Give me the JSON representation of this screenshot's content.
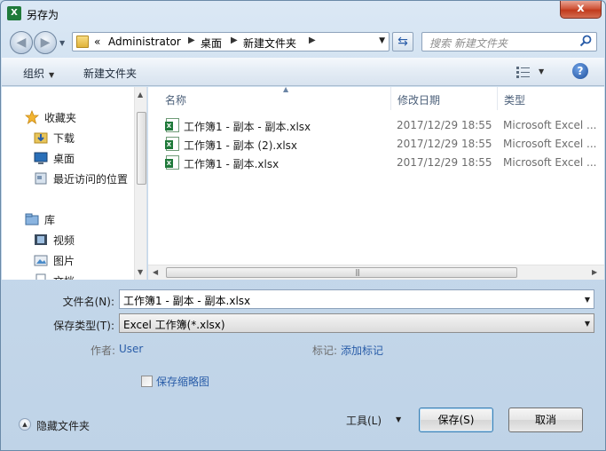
{
  "window": {
    "title": "另存为",
    "app_icon_letter": "X",
    "close_label": "x"
  },
  "nav": {
    "back_symbol": "◀",
    "forward_symbol": "▶",
    "breadcrumb": [
      "Administrator",
      "桌面",
      "新建文件夹"
    ],
    "overflow": "«",
    "refresh_symbol": "⇆",
    "search_placeholder": "搜索 新建文件夹"
  },
  "toolbar": {
    "organize": "组织",
    "new_folder": "新建文件夹",
    "help": "?"
  },
  "sidebar": {
    "items": [
      {
        "label": "收藏夹",
        "icon": "star-icon",
        "level": 0
      },
      {
        "label": "下载",
        "icon": "download-folder-icon",
        "level": 1
      },
      {
        "label": "桌面",
        "icon": "desktop-icon",
        "level": 1
      },
      {
        "label": "最近访问的位置",
        "icon": "recent-places-icon",
        "level": 1
      },
      {
        "label": "库",
        "icon": "library-icon",
        "level": 0
      },
      {
        "label": "视频",
        "icon": "video-library-icon",
        "level": 1
      },
      {
        "label": "图片",
        "icon": "pictures-library-icon",
        "level": 1
      },
      {
        "label": "文档",
        "icon": "documents-library-icon",
        "level": 1
      }
    ]
  },
  "files": {
    "columns": [
      "名称",
      "修改日期",
      "类型"
    ],
    "rows": [
      {
        "name": "工作簿1 - 副本 - 副本.xlsx",
        "date": "2017/12/29 18:55",
        "type": "Microsoft Excel ..."
      },
      {
        "name": "工作簿1 - 副本 (2).xlsx",
        "date": "2017/12/29 18:55",
        "type": "Microsoft Excel ..."
      },
      {
        "name": "工作簿1 - 副本.xlsx",
        "date": "2017/12/29 18:55",
        "type": "Microsoft Excel ..."
      }
    ]
  },
  "form": {
    "filename_label": "文件名(N):",
    "filename_value": "工作簿1 - 副本 - 副本.xlsx",
    "filetype_label": "保存类型(T):",
    "filetype_value": "Excel 工作簿(*.xlsx)",
    "author_label": "作者:",
    "author_value": "User",
    "tags_label": "标记:",
    "tags_value": "添加标记",
    "thumbnail_label": "保存缩略图"
  },
  "footer": {
    "hide_folders": "隐藏文件夹",
    "tools": "工具(L)",
    "save": "保存(S)",
    "cancel": "取消"
  }
}
